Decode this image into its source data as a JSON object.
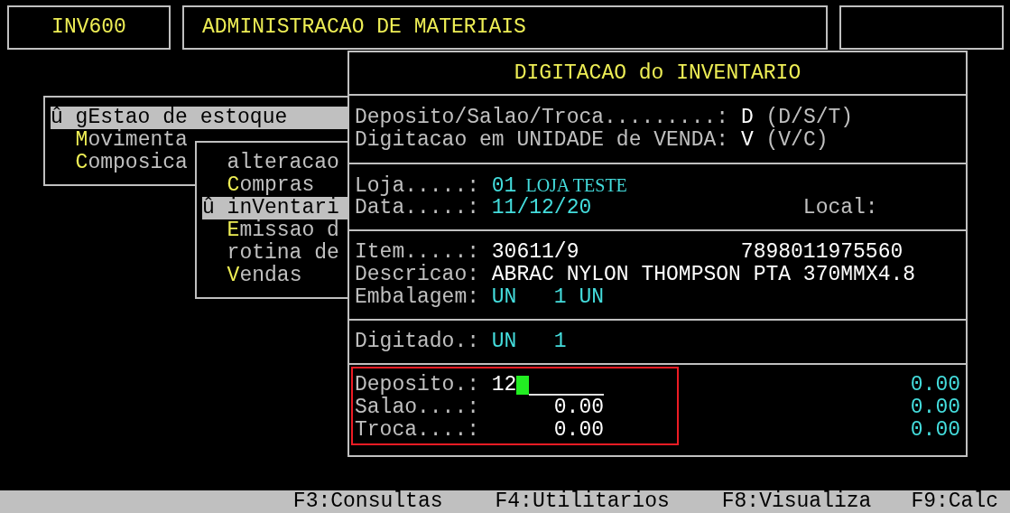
{
  "header": {
    "program": "INV600",
    "title": "ADMINISTRACAO DE MATERIAIS"
  },
  "menu": {
    "items": [
      {
        "marker": "û",
        "text": "gEstao de estoque",
        "selected": true
      },
      {
        "hotkey": "M",
        "text": "ovimenta",
        "selected": false
      },
      {
        "hotkey": "C",
        "text": "omposica",
        "selected": false
      }
    ]
  },
  "submenu": {
    "items": [
      {
        "text": "alteracao",
        "selected": false
      },
      {
        "hotkey": "C",
        "text": "ompras",
        "selected": false
      },
      {
        "marker": "û",
        "text": "inVentari",
        "selected": true
      },
      {
        "hotkey": "E",
        "text": "missao d",
        "selected": false
      },
      {
        "text": "rotina de",
        "selected": false
      },
      {
        "hotkey": "V",
        "text": "endas",
        "selected": false
      }
    ]
  },
  "dialog": {
    "title": "DIGITACAO do INVENTARIO",
    "options": [
      {
        "label": "Deposito/Salao/Troca.........:",
        "value": "D",
        "hint": "(D/S/T)"
      },
      {
        "label": "Digitacao em UNIDADE de VENDA:",
        "value": "V",
        "hint": "(V/C)"
      }
    ],
    "store": {
      "label": "Loja.....:",
      "code": "01",
      "name": "LOJA TESTE"
    },
    "date": {
      "label": "Data.....:",
      "value": "11/12/20",
      "local_label": "Local:"
    },
    "item": {
      "label": "Item.....:",
      "code": "30611/9",
      "barcode": "7898011975560"
    },
    "description": {
      "label": "Descricao:",
      "value": "ABRAC NYLON THOMPSON PTA 370MMX4.8"
    },
    "packaging": {
      "label": "Embalagem:",
      "unit": "UN",
      "quantity": "1 UN"
    },
    "typed": {
      "label": "Digitado.:",
      "unit": "UN",
      "quantity": "1"
    },
    "quantities": [
      {
        "label": "Deposito.:",
        "kind": "input",
        "value": "12",
        "focused": true,
        "total": "0.00"
      },
      {
        "label": "Salao....:",
        "kind": "display",
        "value": "0.00",
        "total": "0.00"
      },
      {
        "label": "Troca....:",
        "kind": "display",
        "value": "0.00",
        "total": "0.00"
      }
    ]
  },
  "function_keys": [
    "F3:Consultas",
    "F4:Utilitarios",
    "F8:Visualiza",
    "F9:Calc"
  ]
}
